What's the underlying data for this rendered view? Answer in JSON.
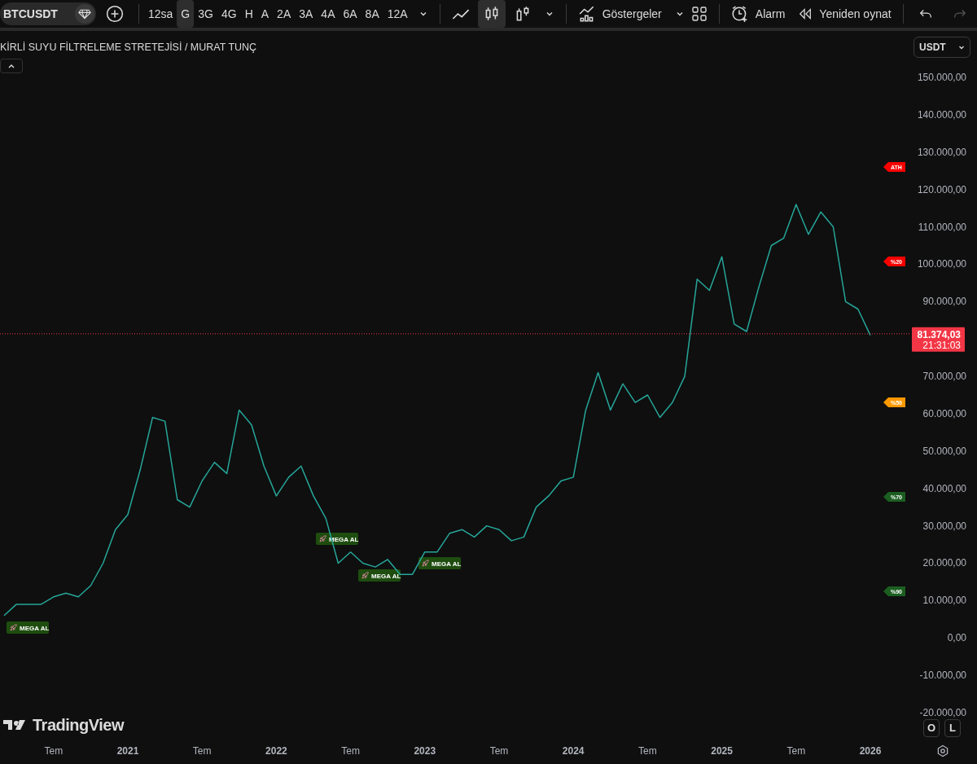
{
  "toolbar": {
    "intervals": [
      {
        "label": "12sa",
        "selected": false
      },
      {
        "label": "G",
        "selected": true
      },
      {
        "label": "3G",
        "selected": false
      },
      {
        "label": "4G",
        "selected": false
      },
      {
        "label": "H",
        "selected": false
      },
      {
        "label": "A",
        "selected": false
      },
      {
        "label": "2A",
        "selected": false
      },
      {
        "label": "3A",
        "selected": false
      },
      {
        "label": "4A",
        "selected": false
      },
      {
        "label": "6A",
        "selected": false
      },
      {
        "label": "8A",
        "selected": false
      },
      {
        "label": "12A",
        "selected": false
      }
    ],
    "chart_types": [
      {
        "kind": "line",
        "selected": false
      },
      {
        "kind": "candles",
        "selected": true
      },
      {
        "kind": "hollow",
        "selected": false
      }
    ],
    "indicators": "Göstergeler",
    "alarm": "Alarm",
    "replay": "Yeniden oynat",
    "undo": {
      "disabled": false
    },
    "redo": {
      "disabled": true
    }
  },
  "chart": {
    "title": "KİRLİ SUYU FİLTRELEME STRETEJİSİ / MURAT TUNÇ",
    "currency": "USDT",
    "logo": "TradingView",
    "scale_buttons": [
      "O",
      "L"
    ],
    "level_tags": [
      {
        "text": "ATH",
        "color": "#f70000"
      },
      {
        "text": "%20",
        "color": "#f70000"
      },
      {
        "text": "%50",
        "color": "#ff9800"
      },
      {
        "text": "%70",
        "color": "#1b5e20"
      },
      {
        "text": "%90",
        "color": "#1b5e20"
      }
    ],
    "countdown": "21:31:03",
    "chart_data": {
      "type": "line",
      "x": [
        "2020-03",
        "2020-04",
        "2020-05",
        "2020-06",
        "2020-07",
        "2020-08",
        "2020-09",
        "2020-10",
        "2020-11",
        "2020-12",
        "2021-01",
        "2021-02",
        "2021-03",
        "2021-04",
        "2021-05",
        "2021-06",
        "2021-07",
        "2021-08",
        "2021-09",
        "2021-10",
        "2021-11",
        "2021-12",
        "2022-01",
        "2022-02",
        "2022-03",
        "2022-04",
        "2022-05",
        "2022-06",
        "2022-07",
        "2022-08",
        "2022-09",
        "2022-10",
        "2022-11",
        "2022-12",
        "2023-01",
        "2023-02",
        "2023-03",
        "2023-04",
        "2023-05",
        "2023-06",
        "2023-07",
        "2023-08",
        "2023-09",
        "2023-10",
        "2023-11",
        "2023-12",
        "2024-01",
        "2024-02",
        "2024-03",
        "2024-04",
        "2024-05",
        "2024-06",
        "2024-07",
        "2024-08",
        "2024-09",
        "2024-10",
        "2024-11",
        "2024-12",
        "2025-01",
        "2025-02",
        "2025-03",
        "2025-04",
        "2025-05",
        "2025-06",
        "2025-07",
        "2025-08",
        "2025-09",
        "2025-10",
        "2025-11",
        "2025-12",
        "2026-01"
      ],
      "series": [
        {
          "name": "BTCUSDT",
          "color": "#26a69a",
          "values": [
            6000,
            9000,
            9000,
            9000,
            11000,
            12000,
            11000,
            14000,
            20000,
            29000,
            33000,
            45000,
            59000,
            58000,
            37000,
            35000,
            42000,
            47000,
            44000,
            61000,
            57000,
            46000,
            38000,
            43000,
            46000,
            38000,
            32000,
            20000,
            23000,
            20000,
            19000,
            21000,
            17000,
            17000,
            23000,
            23000,
            28000,
            29000,
            27000,
            30000,
            29000,
            26000,
            27000,
            35000,
            38000,
            42000,
            43000,
            61000,
            71000,
            61000,
            68000,
            63000,
            65000,
            59000,
            63000,
            70000,
            96000,
            93000,
            102000,
            84000,
            82000,
            94000,
            105000,
            107000,
            116000,
            108000,
            114000,
            110000,
            90000,
            88000,
            81000
          ]
        }
      ],
      "xlim": [
        "2020-03",
        "2026-01"
      ],
      "ylim": [
        -20000,
        150000
      ],
      "xticks": [
        {
          "value": "2020-07",
          "label": "Tem"
        },
        {
          "value": "2021-01",
          "label": "2021"
        },
        {
          "value": "2021-07",
          "label": "Tem"
        },
        {
          "value": "2022-01",
          "label": "2022"
        },
        {
          "value": "2022-07",
          "label": "Tem"
        },
        {
          "value": "2023-01",
          "label": "2023"
        },
        {
          "value": "2023-07",
          "label": "Tem"
        },
        {
          "value": "2024-01",
          "label": "2024"
        },
        {
          "value": "2024-07",
          "label": "Tem"
        },
        {
          "value": "2025-01",
          "label": "2025"
        },
        {
          "value": "2025-07",
          "label": "Tem"
        },
        {
          "value": "2026-01",
          "label": "2026"
        }
      ],
      "yticks": [
        {
          "value": 150000,
          "label": "150.000,00"
        },
        {
          "value": 140000,
          "label": "140.000,00"
        },
        {
          "value": 130000,
          "label": "130.000,00"
        },
        {
          "value": 120000,
          "label": "120.000,00"
        },
        {
          "value": 110000,
          "label": "110.000,00"
        },
        {
          "value": 100000,
          "label": "100.000,00"
        },
        {
          "value": 90000,
          "label": "90.000,00"
        },
        {
          "value": 70000,
          "label": "70.000,00"
        },
        {
          "value": 60000,
          "label": "60.000,00"
        },
        {
          "value": 50000,
          "label": "50.000,00"
        },
        {
          "value": 40000,
          "label": "40.000,00"
        },
        {
          "value": 30000,
          "label": "30.000,00"
        },
        {
          "value": 20000,
          "label": "20.000,00"
        },
        {
          "value": 10000,
          "label": "10.000,00"
        },
        {
          "value": 0,
          "label": "0,00"
        },
        {
          "value": -10000,
          "label": "-10.000,00"
        },
        {
          "value": -20000,
          "label": "-20.000,00"
        }
      ],
      "ref_lines": [
        {
          "axis": "y",
          "value": 81374.03,
          "label": "81.374,03",
          "color": "#f23645"
        }
      ],
      "annotations": [
        "MEGA AL",
        "MEGA AL",
        "MEGA AL",
        "MEGA AL"
      ]
    }
  }
}
